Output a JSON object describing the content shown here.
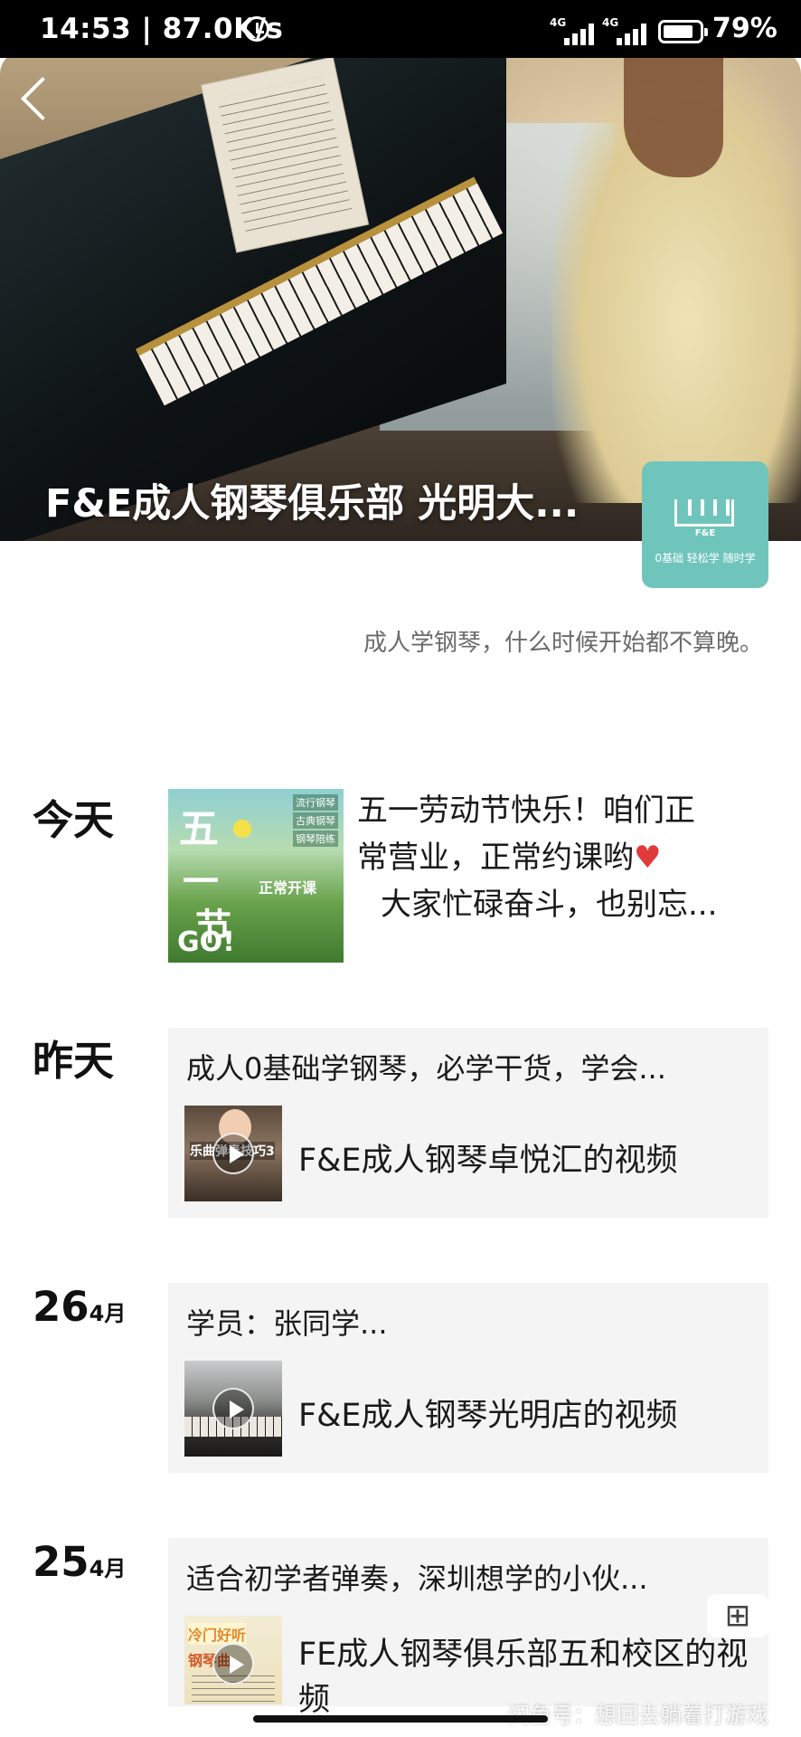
{
  "status_bar": {
    "time_speed": "14:53 | 87.0K/s",
    "net1": "4G",
    "net2": "4G",
    "battery": "79%"
  },
  "header": {
    "title": "F&E成人钢琴俱乐部 光明大...",
    "logo_brand": "F&E",
    "logo_tagline": "0基础 轻松学 随时学",
    "motto": "成人学钢琴，什么时候开始都不算晚。"
  },
  "timeline": [
    {
      "day": "今天",
      "post_text_1": "五一劳动节快乐！咱们正",
      "post_text_2": "常营业，正常约课哟",
      "post_text_3": "大家忙碌奋斗，也别忘...",
      "thumb_text": [
        "五",
        "一",
        "节",
        "GO!"
      ],
      "thumb_kaike": "正常开课",
      "thumb_tags": [
        "流行钢琴",
        "古典钢琴",
        "钢琴陪练"
      ]
    },
    {
      "day": "昨天",
      "text": "成人0基础学钢琴，必学干货，学会...",
      "thumb_caption": "乐曲弹奏技巧3",
      "video_title": "F&E成人钢琴卓悦汇的视频"
    },
    {
      "day": "26",
      "month": "4月",
      "text": "学员：张同学...",
      "video_title": "F&E成人钢琴光明店的视频"
    },
    {
      "day": "25",
      "month": "4月",
      "text": "适合初学者弹奏，深圳想学的小伙...",
      "thumb_caption_1": "冷门好听",
      "thumb_caption_2": "钢琴曲",
      "video_title": "FE成人钢琴俱乐部五和校区的视频"
    }
  ],
  "float_button": "⊞",
  "watermark": "闲鱼号：想回去躺着打游戏",
  "icons": [
    "back-icon",
    "alarm-icon",
    "signal-icon",
    "battery-icon",
    "heart-icon",
    "play-icon"
  ]
}
